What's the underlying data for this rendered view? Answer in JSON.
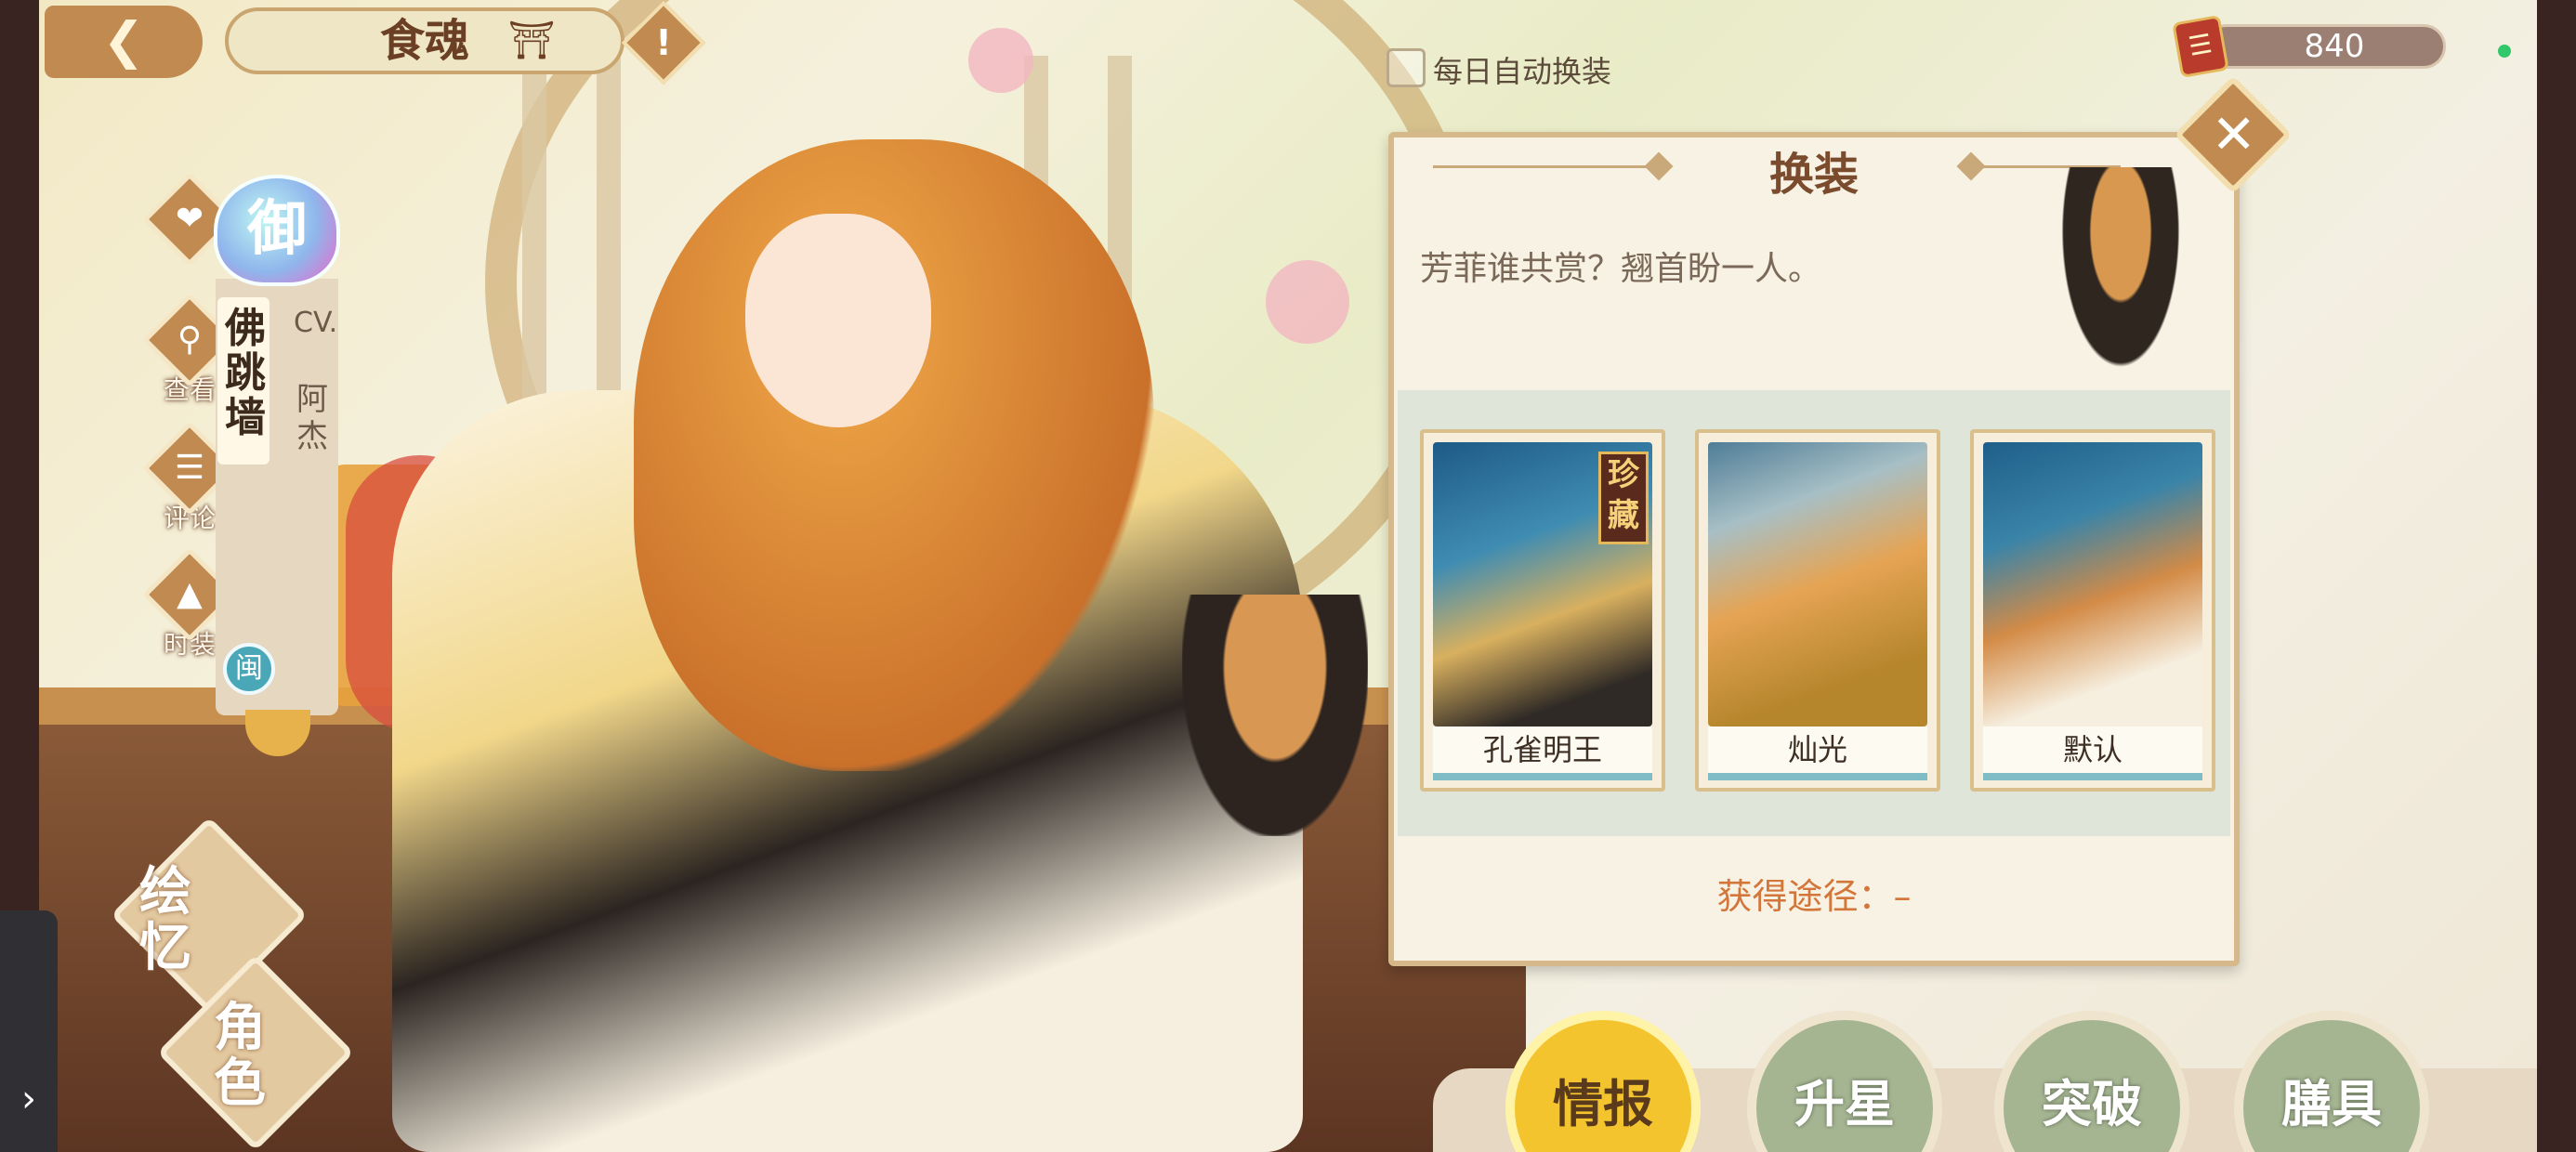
{
  "header": {
    "back_icon": "back-arrow-icon",
    "title": "食魂",
    "pavilion_icon": "pavilion-icon",
    "alert_symbol": "!"
  },
  "auto_outfit": {
    "label": "每日自动换装",
    "checked": false
  },
  "currency": {
    "icon": "book-icon",
    "value": "840"
  },
  "side_menu": {
    "favorite_icon": "heart-icon",
    "view": "查看",
    "comment": "评论",
    "fashion": "时装"
  },
  "character": {
    "rarity": "御",
    "name": "佛跳墙",
    "cv_label": "CV.",
    "cv_name": "阿杰",
    "region": "闽"
  },
  "left_bottom": {
    "memory": "绘忆",
    "role": "角色"
  },
  "bottom_nav": {
    "info": "情报",
    "star_up": "升星",
    "breakthrough": "突破",
    "utensils": "膳具",
    "active": "情报"
  },
  "panel": {
    "title": "换装",
    "quote": "芳菲谁共赏？翘首盼一人。",
    "close_symbol": "✕",
    "skins": [
      {
        "name": "孔雀明王",
        "tag": "珍藏"
      },
      {
        "name": "灿光"
      },
      {
        "name": "默认"
      }
    ],
    "obtain_label": "获得途径：",
    "obtain_value": "–"
  },
  "colors": {
    "accent": "#c08a51",
    "active_nav": "#f3c42d",
    "obtain_text": "#d2763a"
  }
}
